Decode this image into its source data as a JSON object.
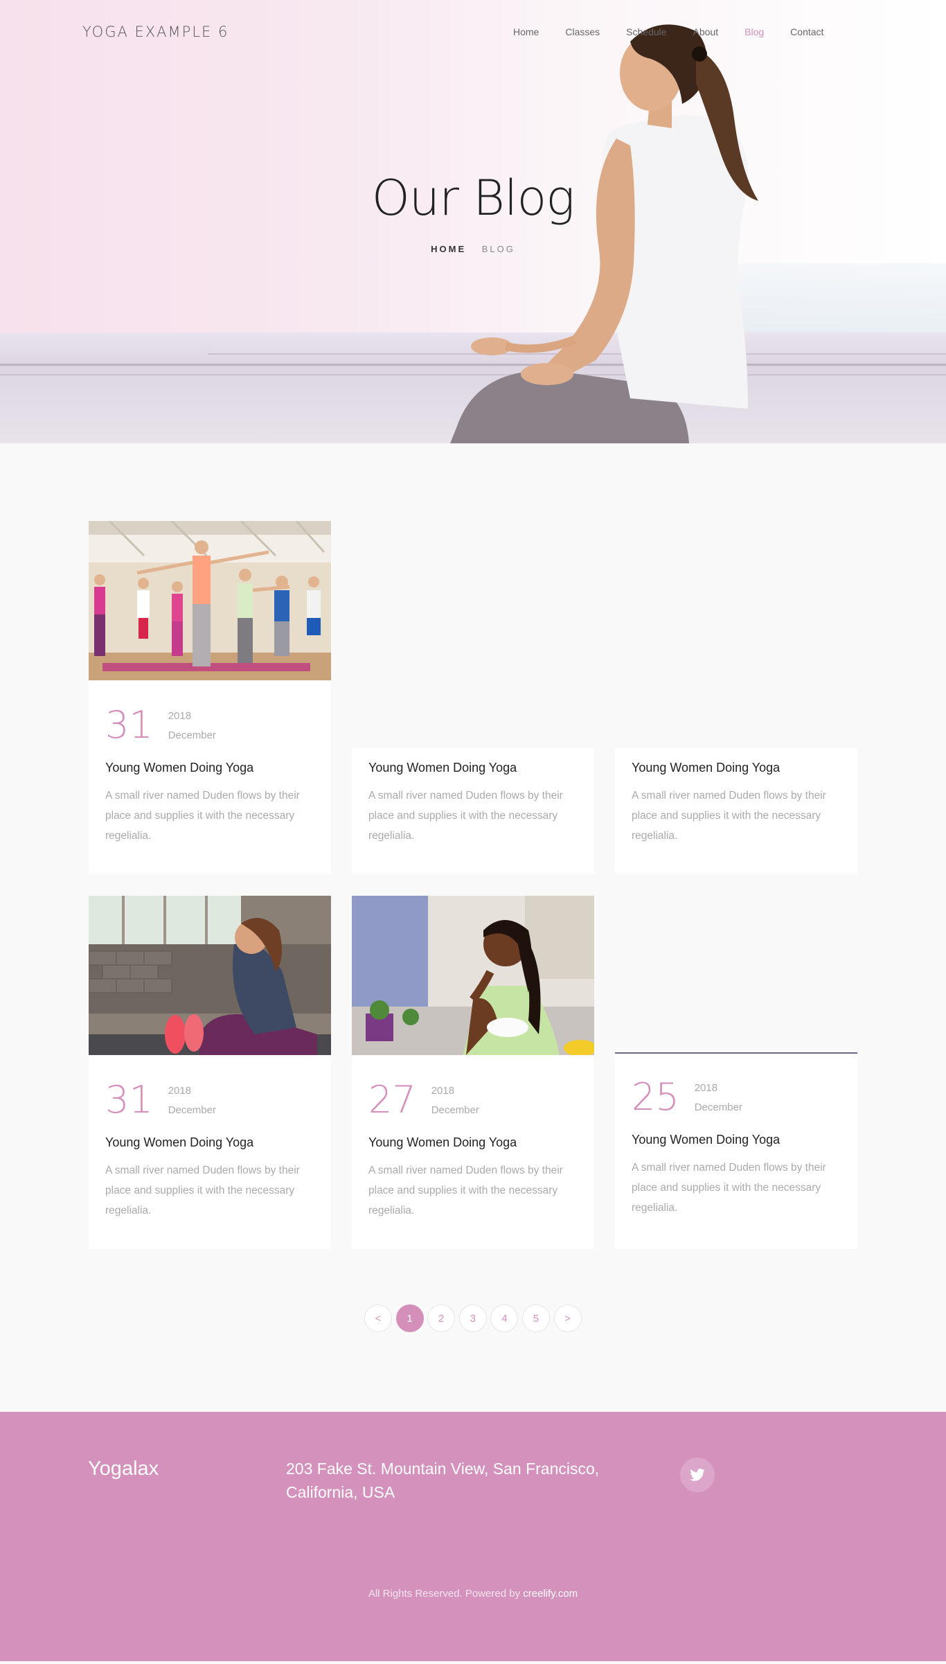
{
  "nav": {
    "brand": "YOGA EXAMPLE 6",
    "items": [
      {
        "label": "Home",
        "active": false
      },
      {
        "label": "Classes",
        "active": false
      },
      {
        "label": "Schedule",
        "active": false
      },
      {
        "label": "About",
        "active": false
      },
      {
        "label": "Blog",
        "active": true
      },
      {
        "label": "Contact",
        "active": false
      }
    ]
  },
  "hero": {
    "title": "Our Blog",
    "breadcrumb_home": "HOME",
    "breadcrumb_current": "BLOG"
  },
  "posts": [
    {
      "day": "31",
      "year": "2018",
      "month": "December",
      "title": "Young Women Doing Yoga",
      "excerpt": "A small river named Duden flows by their place and supplies it with the necessary regelialia.",
      "image": "group-yoga-class"
    },
    {
      "day": "",
      "year": "",
      "month": "",
      "title": "Young Women Doing Yoga",
      "excerpt": "A small river named Duden flows by their place and supplies it with the necessary regelialia.",
      "image": ""
    },
    {
      "day": "",
      "year": "",
      "month": "",
      "title": "Young Women Doing Yoga",
      "excerpt": "A small river named Duden flows by their place and supplies it with the necessary regelialia.",
      "image": ""
    },
    {
      "day": "31",
      "year": "2018",
      "month": "December",
      "title": "Young Women Doing Yoga",
      "excerpt": "A small river named Duden flows by their place and supplies it with the necessary regelialia.",
      "image": "woman-stretching"
    },
    {
      "day": "27",
      "year": "2018",
      "month": "December",
      "title": "Young Women Doing Yoga",
      "excerpt": "A small river named Duden flows by their place and supplies it with the necessary regelialia.",
      "image": "woman-eating-salad"
    },
    {
      "day": "25",
      "year": "2018",
      "month": "December",
      "title": "Young Women Doing Yoga",
      "excerpt": "A small river named Duden flows by their place and supplies it with the necessary regelialia.",
      "image": ""
    }
  ],
  "pagination": {
    "prev": "<",
    "pages": [
      "1",
      "2",
      "3",
      "4",
      "5"
    ],
    "current": "1",
    "next": ">"
  },
  "footer": {
    "logo": "Yogalax",
    "address": "203 Fake St. Mountain View, San Francisco, California, USA",
    "social_icon": "twitter-icon",
    "copyright_prefix": "All Rights Reserved. Powered by ",
    "copyright_link": "creelify.com"
  },
  "colors": {
    "accent": "#d490bb",
    "footer_bg": "#d391bc"
  }
}
